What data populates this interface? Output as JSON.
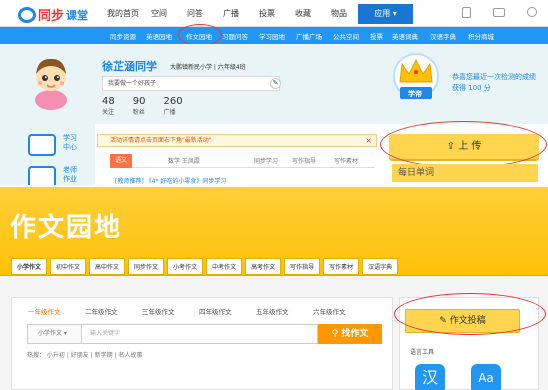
{
  "top": {
    "logo": {
      "part1": "同步",
      "part2": "课堂"
    },
    "main_nav": [
      "我的首页",
      "空间",
      "问答",
      "广播",
      "投票",
      "收藏",
      "物品"
    ],
    "app_button": "应用 ▾",
    "sub_nav": [
      "同步资源",
      "英语园地",
      "作文园地",
      "习题问答",
      "学习园地",
      "广播广场",
      "公共空间",
      "投票",
      "英语词典",
      "汉语字典",
      "积分商城"
    ],
    "profile": {
      "name": "徐芷涵同学",
      "school": "大鹏镇新民小学 | 六年级4班",
      "motto": "我要做一个好孩子",
      "stats": [
        {
          "value": "48",
          "label": "关注"
        },
        {
          "value": "90",
          "label": "粉丝"
        },
        {
          "value": "260",
          "label": "广播"
        }
      ]
    },
    "badge_label": "学帝",
    "congrats": "恭喜您最近一次检测的成绩获得 100 分",
    "side": [
      {
        "label": "学习\n中心"
      },
      {
        "label": "老师\n作业"
      }
    ],
    "notice": "活动详情请点击页面右下角\"最新活动\"",
    "feed_tabs": [
      "语文",
      "数学 王凤霞",
      "同步学习",
      "写作指导",
      "写作素材"
    ],
    "feed_item": "[教师推荐] 《4* 好吃的小零食》同步学习",
    "upload_button": "上 传",
    "daily_words": "每日单词"
  },
  "bottom": {
    "title": "作文园地",
    "tabs": [
      "小学作文",
      "初中作文",
      "高中作文",
      "同步作文",
      "小考作文",
      "中考作文",
      "高考作文",
      "写作指导",
      "写作素材",
      "汉语字典"
    ],
    "grades": [
      "一年级作文",
      "二年级作文",
      "三年级作文",
      "四年级作文",
      "五年级作文",
      "六年级作文"
    ],
    "search": {
      "select": "小学作文 ▾",
      "placeholder": "输入关键字",
      "button": "找作文"
    },
    "hot": "热搜：   小升初  |  好朋友  |  新学期  |  名人故事",
    "submit_button": "作文投稿",
    "lang_tools": "语言工具",
    "tool_glyphs": [
      "汉",
      "Aa"
    ]
  },
  "colors": {
    "blue": "#2196f3",
    "yellow": "#ffc107",
    "orange": "#ff9800",
    "highlight_circle": "#e53935"
  }
}
